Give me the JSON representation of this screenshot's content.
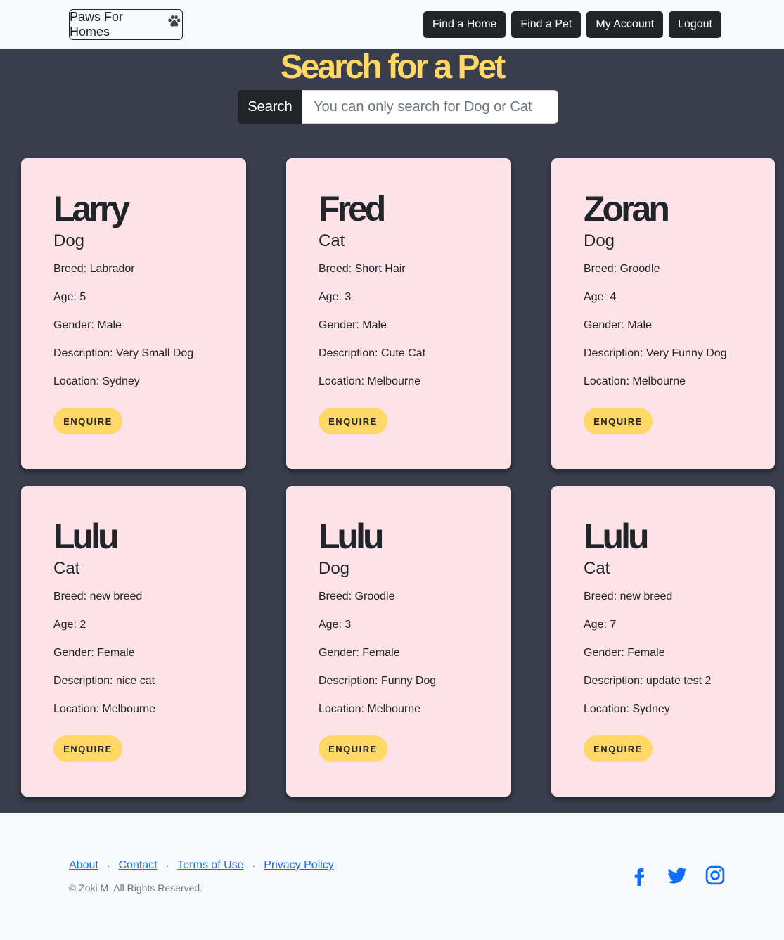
{
  "navbar": {
    "brand": "Paws For Homes",
    "buttons": [
      "Find a Home",
      "Find a Pet",
      "My Account",
      "Logout"
    ]
  },
  "main": {
    "title": "Search for a Pet",
    "search": {
      "label": "Search",
      "placeholder": "You can only search for Dog or Cat",
      "value": ""
    }
  },
  "pets": [
    {
      "name": "Larry",
      "species": "Dog",
      "breed": "Breed: Labrador",
      "age": "Age: 5",
      "gender": "Gender: Male",
      "description": "Description: Very Small Dog",
      "location": "Location: Sydney",
      "button": "ENQUIRE"
    },
    {
      "name": "Fred",
      "species": "Cat",
      "breed": "Breed: Short Hair",
      "age": "Age: 3",
      "gender": "Gender: Male",
      "description": "Description: Cute Cat",
      "location": "Location: Melbourne",
      "button": "ENQUIRE"
    },
    {
      "name": "Zoran",
      "species": "Dog",
      "breed": "Breed: Groodle",
      "age": "Age: 4",
      "gender": "Gender: Male",
      "description": "Description: Very Funny Dog",
      "location": "Location: Melbourne",
      "button": "ENQUIRE"
    },
    {
      "name": "Lulu",
      "species": "Cat",
      "breed": "Breed: new breed",
      "age": "Age: 2",
      "gender": "Gender: Female",
      "description": "Description: nice cat",
      "location": "Location: Melbourne",
      "button": "ENQUIRE"
    },
    {
      "name": "Lulu",
      "species": "Dog",
      "breed": "Breed: Groodle",
      "age": "Age: 3",
      "gender": "Gender: Female",
      "description": "Description: Funny Dog",
      "location": "Location: Melbourne",
      "button": "ENQUIRE"
    },
    {
      "name": "Lulu",
      "species": "Cat",
      "breed": "Breed: new breed",
      "age": "Age: 7",
      "gender": "Gender: Female",
      "description": "Description: update test 2",
      "location": "Location: Sydney",
      "button": "ENQUIRE"
    }
  ],
  "footer": {
    "links": [
      "About",
      "Contact",
      "Terms of Use",
      "Privacy Policy"
    ],
    "separator": "·",
    "copyright": "© Zoki M. All Rights Reserved.",
    "socials": [
      "facebook-icon",
      "twitter-icon",
      "instagram-icon"
    ]
  },
  "colors": {
    "accent": "#ffd866",
    "background": "#383e4c",
    "card": "#fde2e7",
    "dark": "#212529",
    "link": "#0d6efd"
  }
}
